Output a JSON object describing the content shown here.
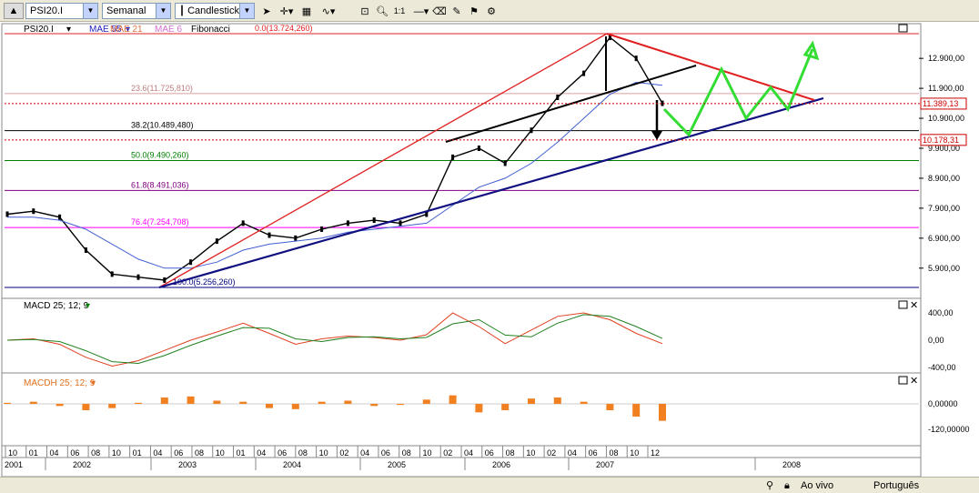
{
  "toolbar": {
    "symbol": "PSI20.I",
    "period": "Semanal",
    "chart_type": "Candlestick",
    "icons": [
      "pointer-icon",
      "crosshair-icon",
      "grid-icon",
      "indicator-icon",
      "zoom-rect-icon",
      "zoom-in-icon",
      "zoom-out-icon",
      "zoom-reset-icon",
      "line-draw-icon",
      "eraser-icon",
      "tools-icon",
      "ticker-icon"
    ],
    "zoom_reset_label": "1:1"
  },
  "main_panel": {
    "legend": {
      "symbol": "PSI20.I",
      "mae55": "MAE 55",
      "mae21": "MAE 21",
      "mae6": "MAE 6",
      "fibonacci": "Fibonacci"
    },
    "fib_levels": [
      {
        "label": "0.0(13.724,260)",
        "value": 13724.26,
        "color": "#e02020"
      },
      {
        "label": "23.6(11.725,810)",
        "value": 11725.81,
        "color": "#d8a0a0"
      },
      {
        "label": "38.2(10.489,480)",
        "value": 10489.48,
        "color": "#000000"
      },
      {
        "label": "50.0(9.490,260)",
        "value": 9490.26,
        "color": "#008000"
      },
      {
        "label": "61.8(8.491,036)",
        "value": 8491.036,
        "color": "#800080"
      },
      {
        "label": "76.4(7.254,708)",
        "value": 7254.708,
        "color": "#ff00ff"
      },
      {
        "label": "100.0(5.256,260)",
        "value": 5256.26,
        "color": "#000080"
      }
    ],
    "y_ticks": [
      "12.900,00",
      "11.900,00",
      "10.900,00",
      "9.900,00",
      "8.900,00",
      "7.900,00",
      "6.900,00",
      "5.900,00"
    ],
    "price_flags": [
      {
        "label": "11.389,13",
        "value": 11389.13,
        "color": "#cc0000"
      },
      {
        "label": "10.178,31",
        "value": 10178.31,
        "color": "#cc0000"
      }
    ]
  },
  "macd_panel": {
    "title": "MACD 25; 12; 9",
    "y_ticks": [
      "400,00",
      "0,00",
      "-400,00"
    ]
  },
  "macdh_panel": {
    "title": "MACDH 25; 12; 9",
    "y_ticks": [
      "0,00000",
      "-120,00000"
    ]
  },
  "x_axis": {
    "month_ticks": [
      "10",
      "01",
      "04",
      "06",
      "08",
      "10",
      "01",
      "04",
      "06",
      "08",
      "10",
      "01",
      "04",
      "06",
      "08",
      "10",
      "02",
      "04",
      "06",
      "08",
      "10",
      "02",
      "04",
      "06",
      "08",
      "10",
      "02",
      "04",
      "06",
      "08",
      "10",
      "12"
    ],
    "year_labels": [
      "2001",
      "2002",
      "2003",
      "2004",
      "2005",
      "2006",
      "2007",
      "2008"
    ]
  },
  "statusbar": {
    "live_label": "Ao vivo",
    "language_label": "Português"
  },
  "chart_data": {
    "type": "line",
    "title": "PSI20.I",
    "xlabel": "",
    "ylabel": "",
    "ylim": [
      5000,
      13900
    ],
    "x": [
      "2001-10",
      "2002-01",
      "2002-04",
      "2002-07",
      "2002-10",
      "2003-01",
      "2003-04",
      "2003-07",
      "2003-10",
      "2004-01",
      "2004-04",
      "2004-07",
      "2004-10",
      "2005-01",
      "2005-04",
      "2005-07",
      "2005-10",
      "2006-01",
      "2006-04",
      "2006-07",
      "2006-10",
      "2007-01",
      "2007-04",
      "2007-07",
      "2007-10",
      "2007-12"
    ],
    "series": [
      {
        "name": "PSI20.I",
        "values": [
          7700,
          7800,
          7600,
          6500,
          5700,
          5600,
          5500,
          6100,
          6800,
          7400,
          7000,
          6900,
          7200,
          7400,
          7500,
          7400,
          7700,
          9600,
          9900,
          9400,
          10500,
          11600,
          12400,
          13600,
          12900,
          11400
        ]
      },
      {
        "name": "MAE 55",
        "values": [
          7600,
          7600,
          7500,
          7200,
          6700,
          6200,
          5900,
          5900,
          6100,
          6500,
          6700,
          6800,
          6900,
          7100,
          7200,
          7300,
          7400,
          8000,
          8600,
          8900,
          9400,
          10100,
          10900,
          11700,
          12100,
          12000
        ]
      }
    ],
    "macd": {
      "ylim": [
        -550,
        450
      ],
      "values": [
        0,
        20,
        -60,
        -250,
        -380,
        -300,
        -150,
        0,
        120,
        250,
        100,
        -60,
        20,
        60,
        40,
        0,
        80,
        400,
        200,
        -50,
        150,
        350,
        400,
        300,
        100,
        -50
      ]
    },
    "macdh": {
      "ylim": [
        -150,
        60
      ],
      "values": [
        5,
        10,
        -10,
        -30,
        -20,
        5,
        30,
        35,
        15,
        10,
        -20,
        -25,
        10,
        15,
        -10,
        -5,
        20,
        40,
        -40,
        -30,
        25,
        30,
        10,
        -30,
        -60,
        -80
      ]
    }
  }
}
